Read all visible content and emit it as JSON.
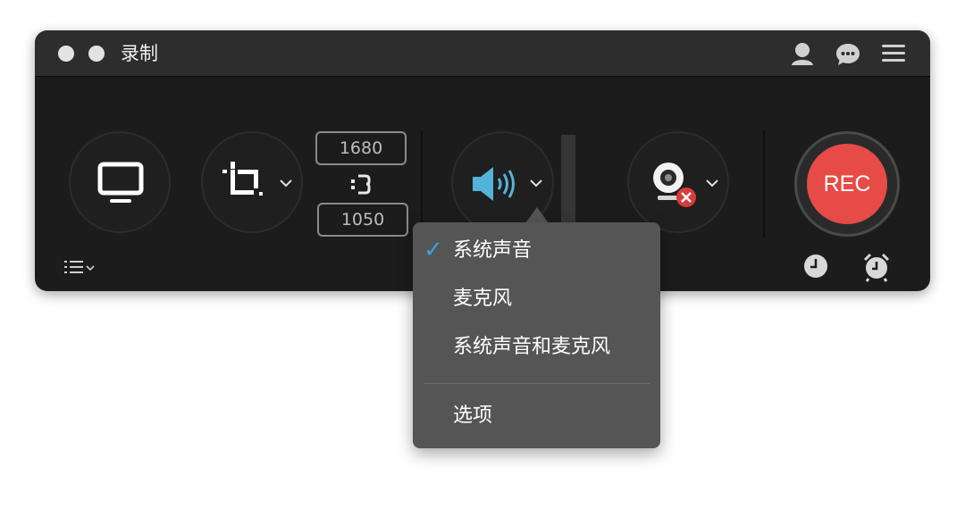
{
  "window": {
    "title": "录制"
  },
  "toolbar": {
    "screen_icon": "monitor-icon",
    "crop_icon": "crop-icon",
    "width": "1680",
    "height": "1050",
    "link_icon": "link-icon",
    "audio_icon": "speaker-icon",
    "webcam_icon": "webcam-icon",
    "rec_label": "REC",
    "rec_color": "#e64b47"
  },
  "audio_menu": {
    "items": [
      {
        "label": "系统声音",
        "checked": true
      },
      {
        "label": "麦克风",
        "checked": false
      },
      {
        "label": "系统声音和麦克风",
        "checked": false
      }
    ],
    "options_label": "选项",
    "check_mark": "✓",
    "check_color": "#3aa3e3"
  }
}
